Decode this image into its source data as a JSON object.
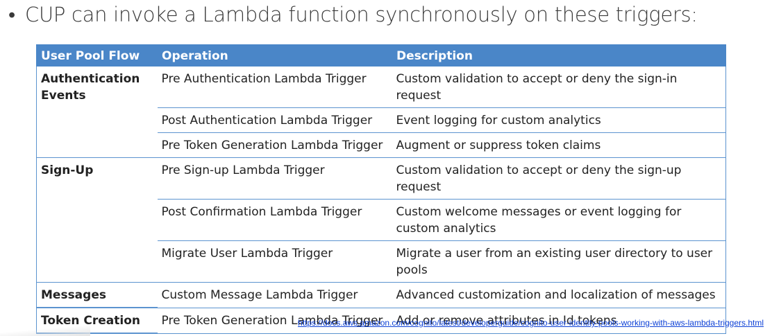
{
  "heading": {
    "bullet": "•",
    "text": "CUP can invoke a Lambda function synchronously on these triggers:"
  },
  "table": {
    "headers": [
      "User Pool Flow",
      "Operation",
      "Description"
    ],
    "groups": [
      {
        "flow": "Authentication Events",
        "rows": [
          {
            "operation": "Pre Authentication Lambda Trigger",
            "description": "Custom validation to accept or deny the sign-in request"
          },
          {
            "operation": "Post Authentication Lambda Trigger",
            "description": "Event logging for custom analytics"
          },
          {
            "operation": "Pre Token Generation Lambda Trigger",
            "description": "Augment or suppress token claims"
          }
        ]
      },
      {
        "flow": "Sign-Up",
        "rows": [
          {
            "operation": "Pre Sign-up Lambda Trigger",
            "description": "Custom validation to accept or deny the sign-up request"
          },
          {
            "operation": "Post Confirmation Lambda Trigger",
            "description": "Custom welcome messages or event logging for custom analytics"
          },
          {
            "operation": "Migrate User Lambda Trigger",
            "description": "Migrate a user from an existing user directory to user pools"
          }
        ]
      },
      {
        "flow": "Messages",
        "rows": [
          {
            "operation": "Custom Message Lambda Trigger",
            "description": "Advanced customization and localization of messages"
          }
        ]
      },
      {
        "flow": "Token Creation",
        "rows": [
          {
            "operation": "Pre Token Generation Lambda Trigger",
            "description": "Add or remove attributes in Id tokens"
          }
        ]
      }
    ]
  },
  "source_link": "https://docs.aws.amazon.com/cognito/latest/developerguide/cognito-user-identity-pools-working-with-aws-lambda-triggers.html",
  "colors": {
    "header_background": "#4a86c8",
    "border": "#5b93cf",
    "link": "#0b3fd6"
  }
}
